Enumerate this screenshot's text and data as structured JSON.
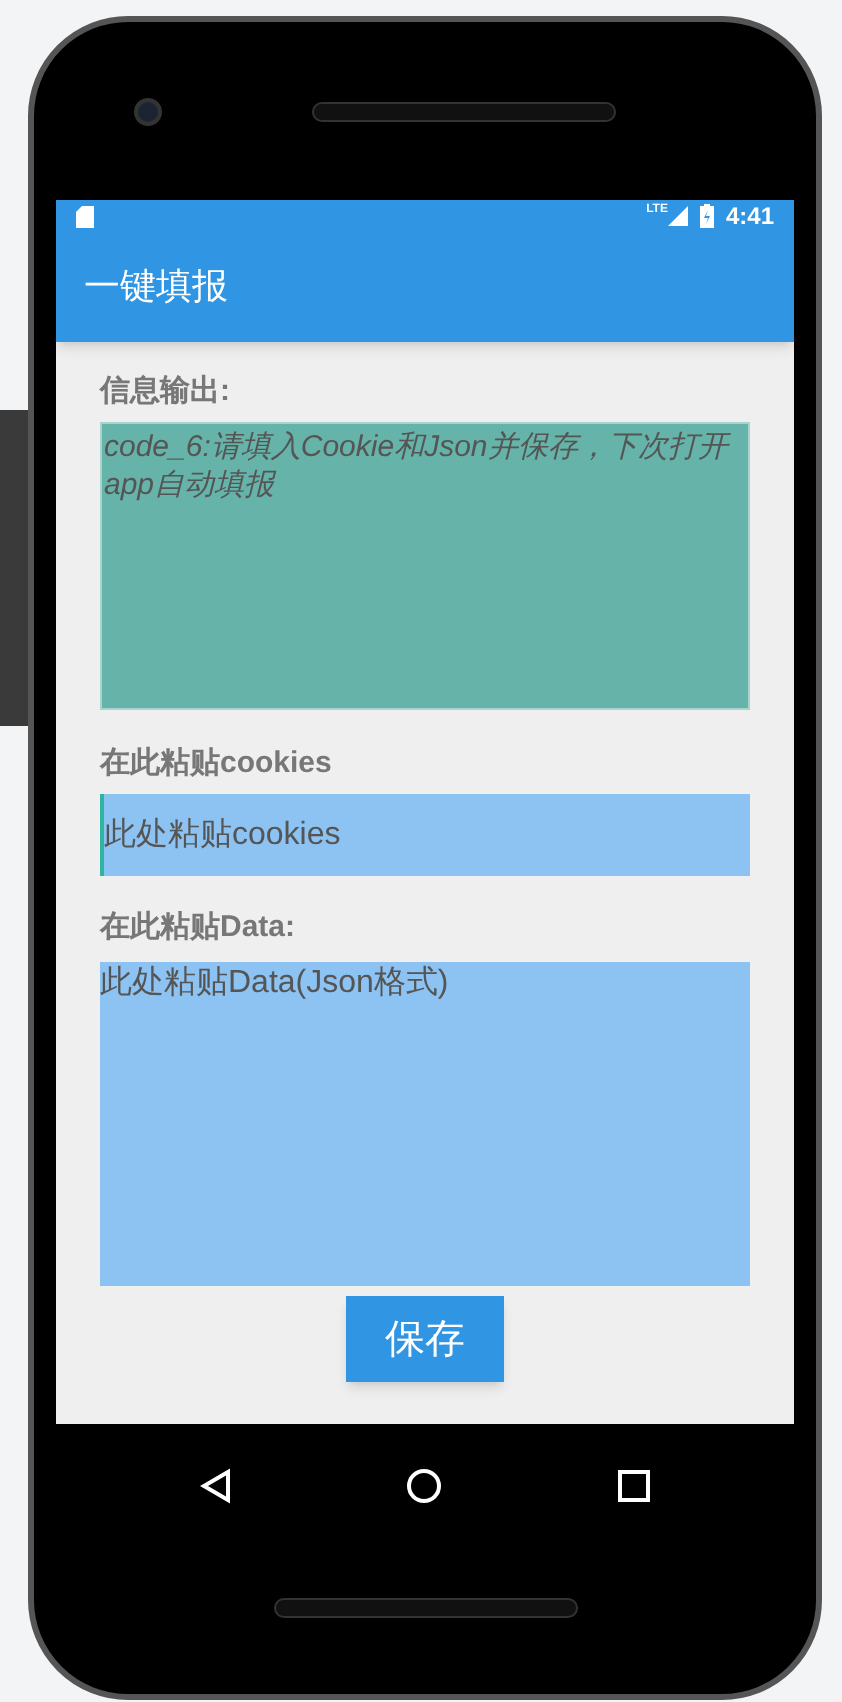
{
  "status_bar": {
    "network": "LTE",
    "time": "4:41"
  },
  "app_bar": {
    "title": "一键填报"
  },
  "output": {
    "label": "信息输出:",
    "text": "code_6:请填入Cookie和Json并保存，下次打开app自动填报"
  },
  "cookies": {
    "label": "在此粘贴cookies",
    "placeholder": "此处粘贴cookies"
  },
  "data": {
    "label": "在此粘贴Data:",
    "placeholder": "此处粘贴Data(Json格式)"
  },
  "buttons": [
    "保存"
  ]
}
